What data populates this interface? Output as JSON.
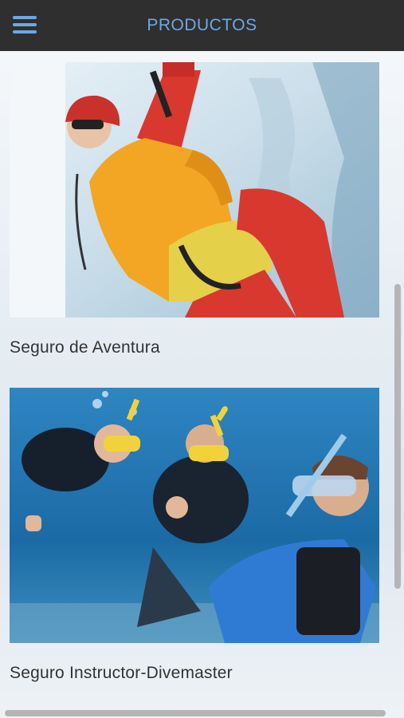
{
  "header": {
    "title": "PRODUCTOS",
    "menu_icon": "hamburger-menu-icon"
  },
  "products": [
    {
      "label": "Seguro de Aventura",
      "image": "ice-climber-photo"
    },
    {
      "label": "Seguro Instructor-Divemaster",
      "image": "scuba-divers-photo"
    }
  ],
  "colors": {
    "header_bg": "#2f2f2f",
    "accent": "#6ea7e3"
  }
}
